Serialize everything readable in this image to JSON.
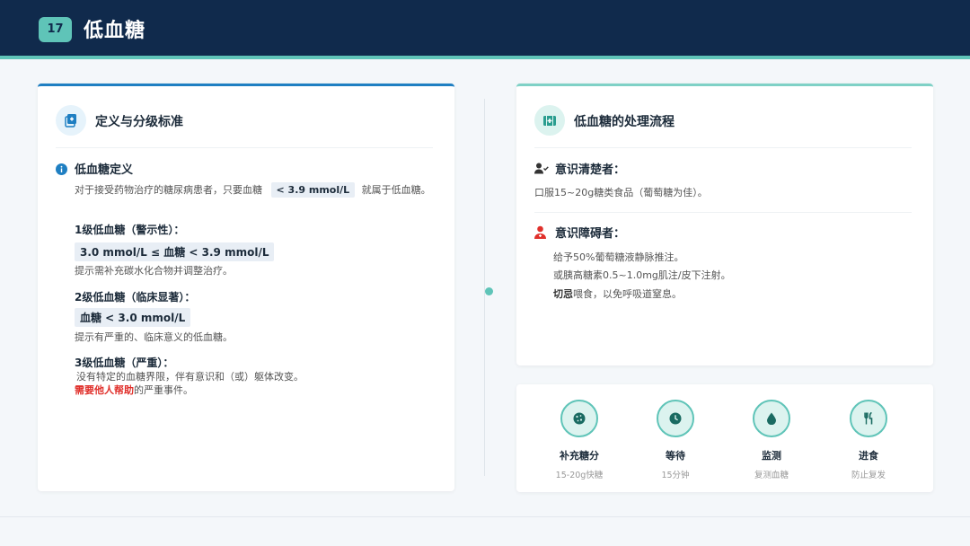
{
  "header": {
    "page_number": "17",
    "title": "低血糖"
  },
  "left": {
    "title": "定义与分级标准",
    "definition": {
      "title": "低血糖定义",
      "text_before": "对于接受药物治疗的糖尿病患者，只要血糖",
      "threshold": "< 3.9 mmol/L",
      "text_after": "就属于低血糖。"
    },
    "level1": {
      "title": "1级低血糖（警示性）：",
      "range": "3.0 mmol/L ≤ 血糖 < 3.9 mmol/L",
      "note": "提示需补充碳水化合物并调整治疗。"
    },
    "level2": {
      "title": "2级低血糖（临床显著）：",
      "range": "血糖 < 3.0 mmol/L",
      "note": "提示有严重的、临床意义的低血糖。"
    },
    "level3": {
      "title": "3级低血糖（严重）：",
      "note": "没有特定的血糖界限，伴有意识和（或）躯体改变。",
      "emphasis": "需要他人帮助",
      "note_tail": "的严重事件。"
    }
  },
  "right": {
    "title": "低血糖的处理流程",
    "conscious": {
      "title": "意识清楚者：",
      "text": "口服15~20g糖类食品（葡萄糖为佳）。"
    },
    "impaired": {
      "title": "意识障碍者：",
      "line1": "给予50%葡萄糖液静脉推注。",
      "line2": "或胰高糖素0.5~1.0mg肌注/皮下注射。",
      "line3_emph": "切忌",
      "line3_rest": "喂食，以免呼吸道窒息。"
    }
  },
  "flow": [
    {
      "label": "补充糖分",
      "sub": "15-20g快糖",
      "icon": "cookie-icon"
    },
    {
      "label": "等待",
      "sub": "15分钟",
      "icon": "clock-icon"
    },
    {
      "label": "监测",
      "sub": "复测血糖",
      "icon": "drop-icon"
    },
    {
      "label": "进食",
      "sub": "防止复发",
      "icon": "utensils-icon"
    }
  ],
  "colors": {
    "navy": "#102a4c",
    "teal": "#5fc4b8",
    "blue": "#1f7fc2",
    "red": "#e0302b"
  }
}
